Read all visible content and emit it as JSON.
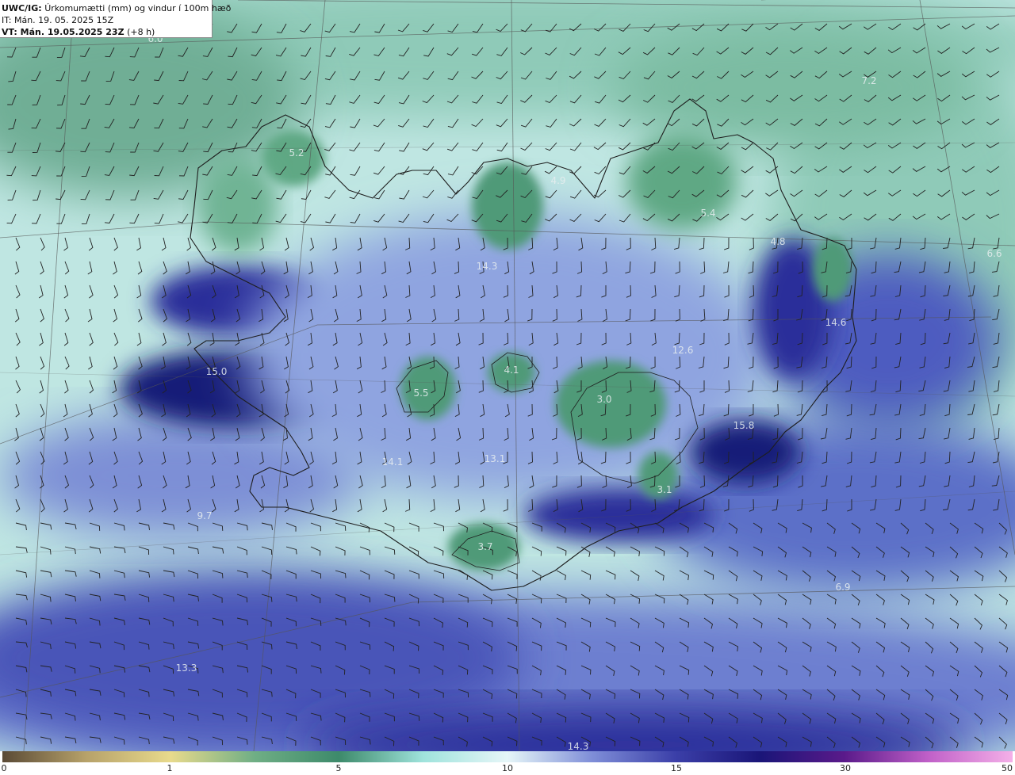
{
  "header": {
    "product": "UWC/IG:",
    "description": "Úrkomumætti (mm) og vindur í 100m hæð",
    "init_time": "IT: Mán. 19. 05. 2025 15Z",
    "valid_label": "VT: Mán. 19.05.2025 23Z",
    "valid_offset": "(+8 h)"
  },
  "colorbar": {
    "ticks": [
      "0",
      "1",
      "5",
      "10",
      "15",
      "30",
      "50"
    ],
    "colors": [
      "#5a4a36",
      "#b7a26a",
      "#e8da8c",
      "#6fae85",
      "#3d8a6b",
      "#9fe3dc",
      "#e6f6f8",
      "#7f8ed8",
      "#3b3fa8",
      "#1a1578",
      "#5a1a8a",
      "#c060c8",
      "#f4b0e8"
    ]
  },
  "map": {
    "values": [
      {
        "text": "6.0"
      },
      {
        "text": "7.2"
      },
      {
        "text": "5.2"
      },
      {
        "text": "4.9"
      },
      {
        "text": "5.4"
      },
      {
        "text": "4.8"
      },
      {
        "text": "6.6"
      },
      {
        "text": "14.3"
      },
      {
        "text": "14.6"
      },
      {
        "text": "12.6"
      },
      {
        "text": "15.0"
      },
      {
        "text": "4.1"
      },
      {
        "text": "5.5"
      },
      {
        "text": "3.0"
      },
      {
        "text": "15.8"
      },
      {
        "text": "14.1"
      },
      {
        "text": "13.1"
      },
      {
        "text": "3.7"
      },
      {
        "text": "13.3"
      },
      {
        "text": "14.3"
      },
      {
        "text": "6.9"
      },
      {
        "text": "9.7"
      },
      {
        "text": "3.1"
      }
    ],
    "palette": {
      "ocean_light": "#bfe6e2",
      "ocean_teal": "#8fcab8",
      "land_green": "#4f9a78",
      "heavy_blue": "#2a2f9a",
      "deep_blue": "#141a78",
      "mid_blue": "#6d7fd0",
      "coast": "#1e1e1e",
      "grid": "#555555",
      "barb": "#222222"
    }
  }
}
